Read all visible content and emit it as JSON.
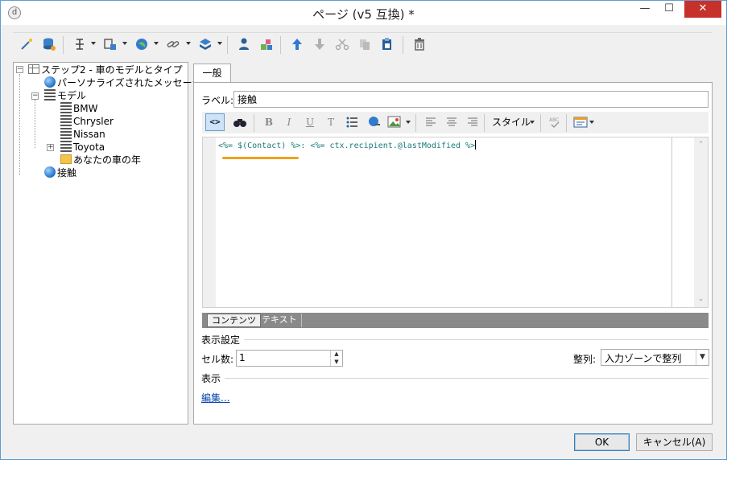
{
  "window": {
    "title": "ページ (v5 互換) *",
    "icon_text": "d",
    "controls": {
      "minimize": "—",
      "maximize": "☐",
      "close": "✕"
    }
  },
  "toolbar": {
    "icons": [
      "wand-icon",
      "database-icon",
      "insert-field-icon",
      "insert-block-icon",
      "globe-icon",
      "link-icon",
      "stack-icon",
      "person-icon",
      "add-person-icon",
      "move-up-icon",
      "move-down-icon",
      "cut-icon",
      "copy-icon",
      "paste-icon",
      "delete-icon"
    ]
  },
  "tree": {
    "items": [
      {
        "label": "ステップ2 - 車のモデルとタイプ",
        "icon": "grid-icon",
        "expanded": true,
        "level": 0
      },
      {
        "label": "パーソナライズされたメッセージ",
        "icon": "globe-icon",
        "level": 1
      },
      {
        "label": "モデル",
        "icon": "list-icon",
        "expanded": true,
        "level": 1
      },
      {
        "label": "BMW",
        "icon": "list-icon",
        "level": 2
      },
      {
        "label": "Chrysler",
        "icon": "list-icon",
        "level": 2
      },
      {
        "label": "Nissan",
        "icon": "list-icon",
        "level": 2
      },
      {
        "label": "Toyota",
        "icon": "list-icon",
        "level": 2,
        "collapsed": true
      },
      {
        "label": "あなたの車の年",
        "icon": "folder-icon",
        "level": 2
      },
      {
        "label": "接触",
        "icon": "globe-icon",
        "level": 1
      }
    ]
  },
  "main": {
    "tab_label": "一般",
    "label_caption": "ラベル:",
    "label_value": "接触",
    "editor_toolbar": {
      "bold": "B",
      "italic": "I",
      "underline": "U",
      "clear_format": "T",
      "style_label": "スタイル",
      "code_button": "<>"
    },
    "code": "<%= $(Contact) %>: <%= ctx.recipient.@lastModified %>",
    "bottom_tabs": [
      "コンテンツ",
      "テキスト"
    ],
    "display_settings": {
      "title": "表示設定",
      "cells_label": "セル数:",
      "cells_value": "1",
      "align_label": "整列:",
      "align_value": "入力ゾーンで整列"
    },
    "display": {
      "title": "表示",
      "edit_link": "編集..."
    }
  },
  "buttons": {
    "ok": "OK",
    "cancel": "キャンセル(A)"
  },
  "colors": {
    "accent_highlight": "#f0a01e",
    "close_button": "#c7312b",
    "code_text": "#1a7a7a",
    "link": "#0645ad"
  }
}
